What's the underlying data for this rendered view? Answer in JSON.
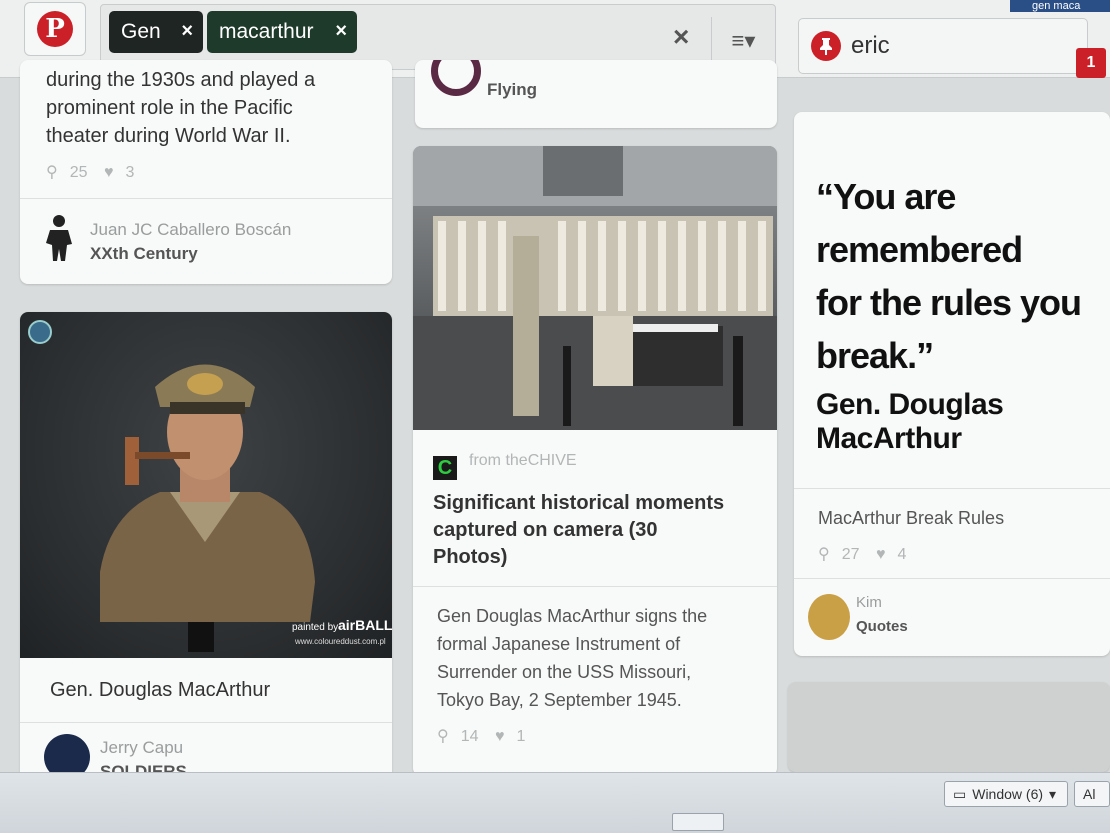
{
  "header": {
    "logo_letter": "P",
    "search_chips": [
      {
        "label": "Gen",
        "remove": "×"
      },
      {
        "label": "macarthur",
        "remove": "×"
      }
    ],
    "clear_label": "×",
    "menu_icon": "≡▾",
    "user_name": "eric",
    "notification_count": "1",
    "corner_tab_text": "gen maca"
  },
  "pins": {
    "card1": {
      "description_lines": [
        "during the 1930s and played a",
        "prominent role in the Pacific",
        "theater during World War II."
      ],
      "repins": "25",
      "likes": "3",
      "pinner": "Juan JC Caballero Boscán",
      "board": "XXth Century"
    },
    "card2": {
      "credit_line1": "painted by airBALL",
      "credit_line2": "www.coloureddust.com.pl",
      "description": "Gen. Douglas MacArthur",
      "pinner": "Jerry Capu",
      "board": "SOLDIERS"
    },
    "card3": {
      "board": "Flying"
    },
    "card4": {
      "source": "from theCHIVE",
      "title_lines": [
        "Significant historical moments",
        "captured on camera (30",
        "Photos)"
      ],
      "description_lines": [
        "Gen Douglas MacArthur signs the",
        "formal Japanese Instrument of",
        "Surrender on the USS Missouri,",
        "Tokyo Bay, 2 September 1945."
      ],
      "repins": "14",
      "likes": "1"
    },
    "card5": {
      "quote_lines": [
        "“You are remembered",
        "for the rules you",
        "break.”"
      ],
      "quote_author": "Gen. Douglas MacArthur",
      "description": "MacArthur Break Rules",
      "repins": "27",
      "likes": "4",
      "pinner": "Kim",
      "board": "Quotes"
    }
  },
  "taskbar": {
    "window_button": "Window (6)",
    "second_button": "Al"
  },
  "colors": {
    "brand_red": "#cb2027",
    "chip_dark": "#1e2522",
    "chip_green": "#1e3a2a"
  }
}
